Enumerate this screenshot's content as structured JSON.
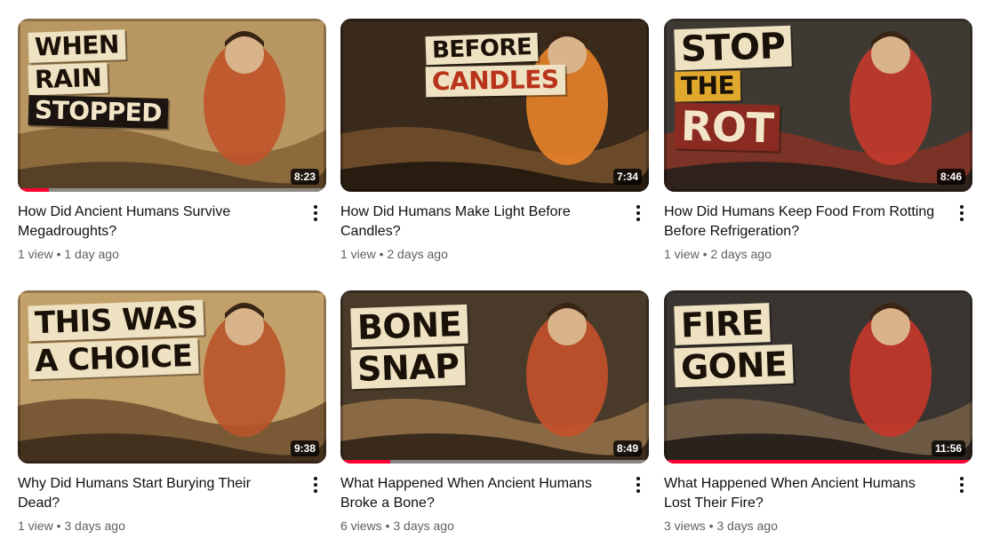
{
  "videos": [
    {
      "title": "How Did Ancient Humans Survive Megadroughts?",
      "views": "1 view",
      "age": "1 day ago",
      "duration": "8:23",
      "thumb_text": [
        "WHEN",
        "RAIN",
        "STOPPED"
      ],
      "watched_fraction": 0.1,
      "palette": {
        "bg": "#b99762",
        "mid": "#8c6a3c",
        "dark": "#4d3a22",
        "accent": "#c0542a"
      }
    },
    {
      "title": "How Did Humans Make Light Before Candles?",
      "views": "1 view",
      "age": "2 days ago",
      "duration": "7:34",
      "thumb_text": [
        "BEFORE",
        "CANDLES"
      ],
      "watched_fraction": 0,
      "palette": {
        "bg": "#3a2a1c",
        "mid": "#6b4a2a",
        "dark": "#1c130c",
        "accent": "#e8832a"
      }
    },
    {
      "title": "How Did Humans Keep Food From Rotting Before Refrigeration?",
      "views": "1 view",
      "age": "2 days ago",
      "duration": "8:46",
      "thumb_text": [
        "STOP",
        "THE",
        "ROT"
      ],
      "watched_fraction": 0,
      "palette": {
        "bg": "#3e3a33",
        "mid": "#7a3326",
        "dark": "#22201c",
        "accent": "#c43a2e"
      }
    },
    {
      "title": "Why Did Humans Start Burying Their Dead?",
      "views": "1 view",
      "age": "3 days ago",
      "duration": "9:38",
      "thumb_text": [
        "THIS WAS",
        "A CHOICE"
      ],
      "watched_fraction": 0,
      "palette": {
        "bg": "#c2a06a",
        "mid": "#7a5a36",
        "dark": "#3a2a1a",
        "accent": "#b9542a"
      }
    },
    {
      "title": "What Happened When Ancient Humans Broke a Bone?",
      "views": "6 views",
      "age": "3 days ago",
      "duration": "8:49",
      "thumb_text": [
        "BONE",
        "SNAP"
      ],
      "watched_fraction": 0.16,
      "palette": {
        "bg": "#4a3a2a",
        "mid": "#8a6a44",
        "dark": "#2a1e14",
        "accent": "#c4512a"
      }
    },
    {
      "title": "What Happened When Ancient Humans Lost Their Fire?",
      "views": "3 views",
      "age": "3 days ago",
      "duration": "11:56",
      "thumb_text": [
        "FIRE",
        "GONE"
      ],
      "watched_fraction": 1,
      "palette": {
        "bg": "#3a3530",
        "mid": "#6e5a44",
        "dark": "#1e1a16",
        "accent": "#c8362a"
      }
    }
  ]
}
